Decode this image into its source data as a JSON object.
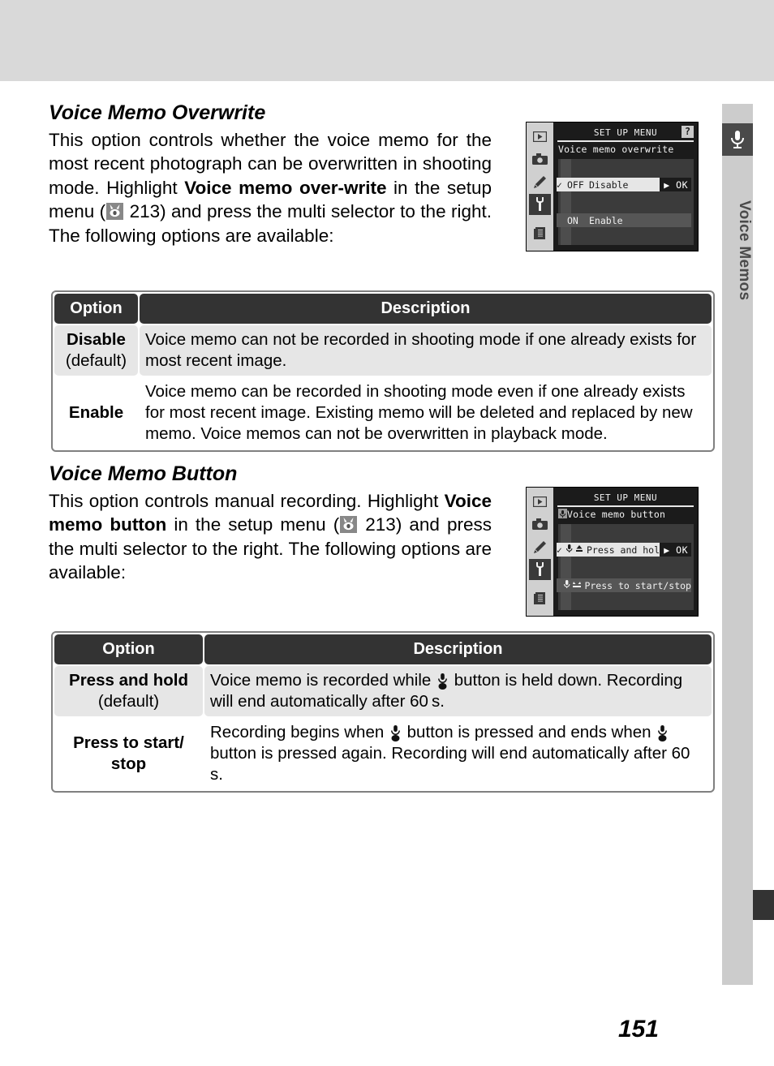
{
  "sidebar": {
    "icon": "microphone-icon",
    "label": "Voice Memos"
  },
  "page_number": "151",
  "sections": [
    {
      "title": "Voice Memo Overwrite",
      "paragraph_parts": {
        "p1": "This option controls whether the voice memo for the most recent photograph can be overwritten in shooting mode.  Highlight ",
        "bold1": "Voice memo over-write",
        "p2": " in the setup menu (",
        "ref_icon": "book-reference-icon",
        "ref_page": " 213) and press the multi selector to the right.  The following options are available:"
      }
    },
    {
      "title": "Voice Memo Button",
      "paragraph_parts": {
        "p1": "This option controls manual recording.  Highlight ",
        "bold1": "Voice memo button",
        "p2": " in the setup menu (",
        "ref_icon": "book-reference-icon",
        "ref_page": " 213) and press the multi selector to the right.  The following options are available:"
      }
    }
  ],
  "lcd_screens": [
    {
      "title": "SET UP MENU",
      "help_badge": "?",
      "subtitle": "Voice memo overwrite",
      "subtitle_icon": "",
      "sidebar_icons": [
        "playback-icon",
        "camera-icon",
        "pencil-icon",
        "wrench-icon",
        "pages-icon"
      ],
      "selected_sidebar_index": 3,
      "rows": [
        {
          "check": "✓",
          "tag": "OFF",
          "label": "Disable",
          "ok": "▶ OK",
          "state": "highlighted"
        },
        {
          "check": "",
          "tag": "ON",
          "label": "Enable",
          "ok": "",
          "state": "dim"
        }
      ]
    },
    {
      "title": "SET UP MENU",
      "help_badge": "",
      "subtitle": "Voice memo button",
      "subtitle_icon": "mic-icon",
      "sidebar_icons": [
        "playback-icon",
        "camera-icon",
        "pencil-icon",
        "wrench-icon",
        "pages-icon"
      ],
      "selected_sidebar_index": 3,
      "rows": [
        {
          "check": "✓",
          "tag": "",
          "label": "Press and hold",
          "ok": "▶ OK",
          "state": "highlighted",
          "icons": "mic-hold-icon"
        },
        {
          "check": "",
          "tag": "",
          "label": "Press to start/stop",
          "ok": "",
          "state": "dim",
          "icons": "mic-toggle-icon"
        }
      ]
    }
  ],
  "tables": [
    {
      "headers": {
        "option": "Option",
        "description": "Description"
      },
      "rows": [
        {
          "option": "Disable",
          "option_note": "(default)",
          "description": "Voice memo can not be recorded in shooting mode if one already exists for most recent image."
        },
        {
          "option": "Enable",
          "option_note": "",
          "description": "Voice memo can be recorded in shooting mode even if one already exists for most recent image.  Existing memo will be deleted and replaced by new memo.  Voice memos can not be overwritten in playback mode."
        }
      ]
    },
    {
      "headers": {
        "option": "Option",
        "description": "Description"
      },
      "rows": [
        {
          "option": "Press and hold",
          "option_note": "(default)",
          "desc_part1": "Voice memo is recorded while ",
          "desc_icon": "mic-button-icon",
          "desc_part2": " button is held down.  Recording will end automatically after 60 s."
        },
        {
          "option": "Press to start/",
          "option_line2": "stop",
          "option_note": "",
          "desc_part1": "Recording begins when ",
          "desc_icon": "mic-button-icon",
          "desc_part2": " button is pressed and ends when ",
          "desc_icon2": "mic-button-icon",
          "desc_part3": " button is pressed again.  Recording will end automatically after 60 s."
        }
      ]
    }
  ]
}
